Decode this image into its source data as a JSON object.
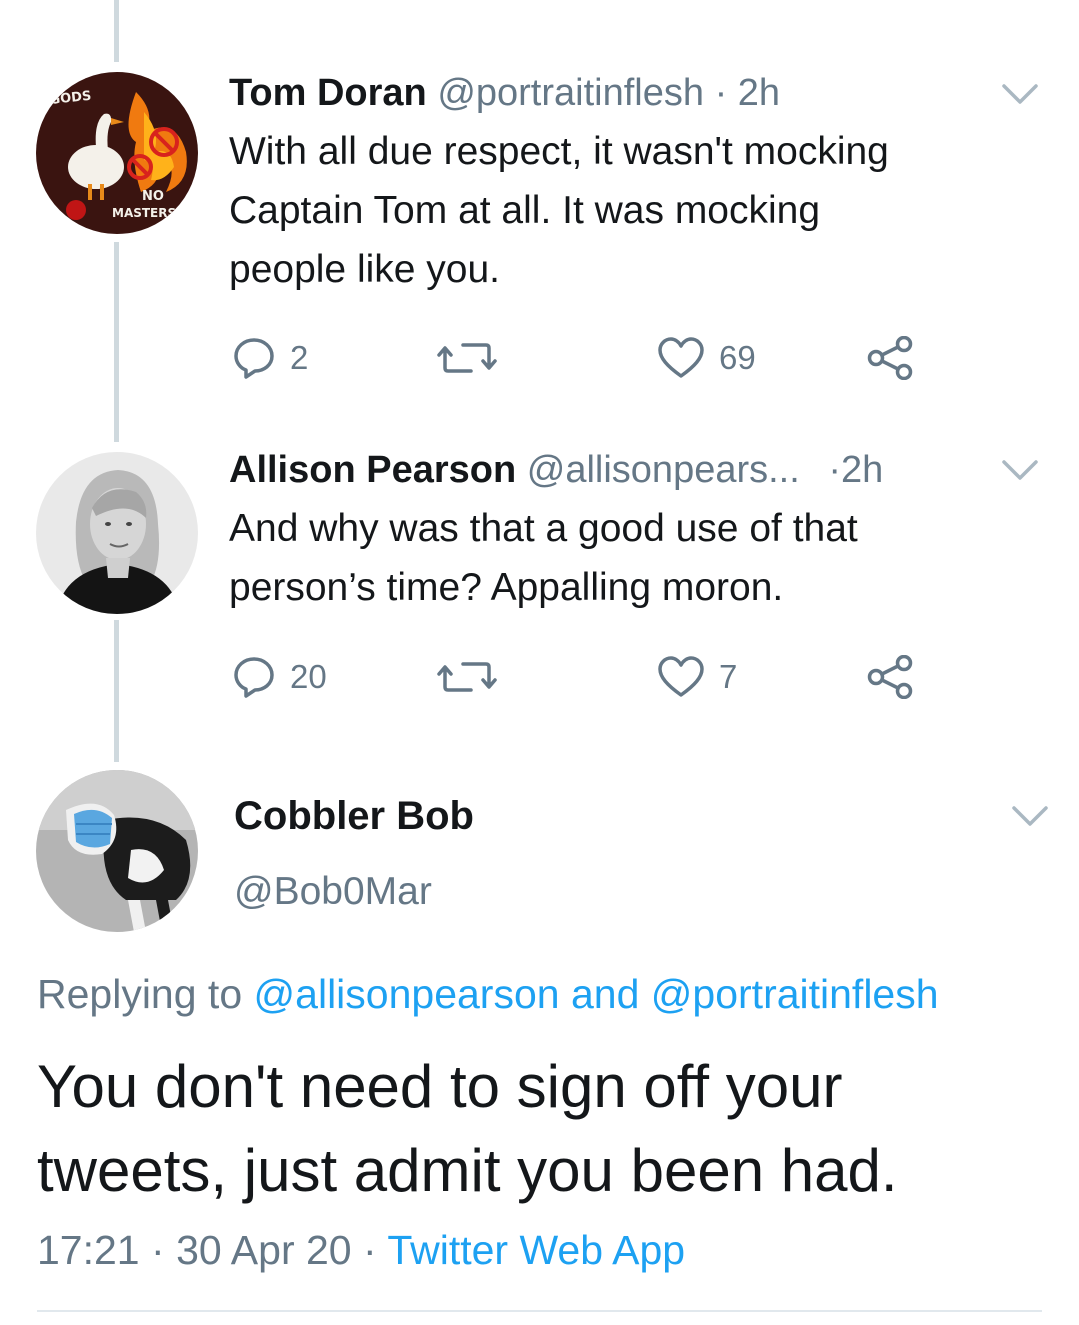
{
  "tweets": [
    {
      "name": "Tom Doran",
      "handle": "@portraitinflesh",
      "dot": "·",
      "time": "2h",
      "text_lines": [
        "With all due respect, it wasn't mocking",
        "Captain Tom at all. It was mocking",
        "people like you."
      ],
      "replies": "2",
      "retweets": "",
      "likes": "69",
      "avatar_lettering": [
        "GODS",
        "NO",
        "MASTERS"
      ]
    },
    {
      "name": "Allison Pearson",
      "handle": "@allisonpears...",
      "dot": "·",
      "time": "2h",
      "text_lines": [
        "And why was that a good use of that",
        "person’s time? Appalling moron."
      ],
      "replies": "20",
      "retweets": "",
      "likes": "7"
    }
  ],
  "main_tweet": {
    "name": "Cobbler Bob",
    "handle": "@Bob0Mar",
    "replying_prefix": "Replying to",
    "replying_to_1": "@allisonpearson",
    "replying_and": "and",
    "replying_to_2": "@portraitinflesh",
    "text_lines": [
      "You don't need to sign off your",
      "tweets, just admit you been had."
    ],
    "time": "17:21",
    "sep": "·",
    "date": "30 Apr 20",
    "source": "Twitter Web App"
  },
  "icons": {
    "reply": "reply-bubble-icon",
    "retweet": "retweet-icon",
    "like": "heart-icon",
    "share": "share-icon",
    "more": "chevron-down-icon"
  },
  "colors": {
    "link": "#1da1f2",
    "secondary_text": "#657786",
    "thread_line": "#cfd9de"
  }
}
